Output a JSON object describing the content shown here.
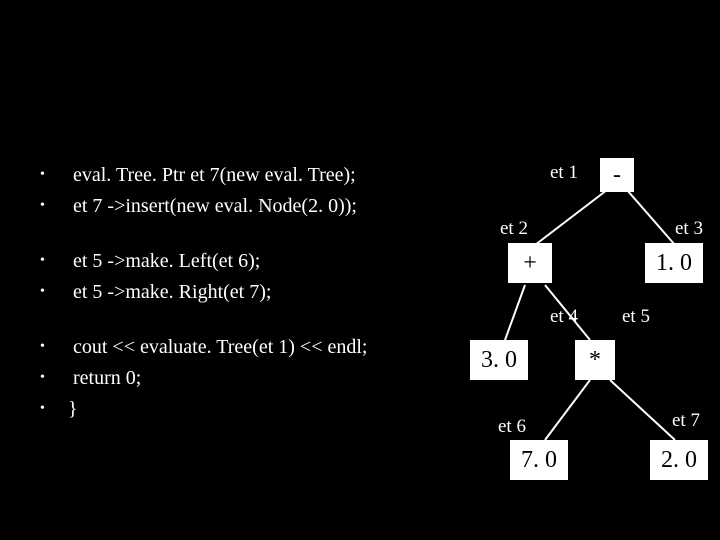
{
  "code": {
    "lines": [
      " eval. Tree. Ptr et 7(new eval. Tree); ",
      " et 7 ->insert(new eval. Node(2. 0));",
      "",
      " et 5 ->make. Left(et 6);",
      " et 5 ->make. Right(et 7);",
      "",
      " cout << evaluate. Tree(et 1) << endl;",
      " return 0;",
      "} "
    ]
  },
  "tree": {
    "labels": {
      "et1": "et 1",
      "et2": "et 2",
      "et3": "et 3",
      "et4": "et 4",
      "et5": "et 5",
      "et6": "et 6",
      "et7": "et 7"
    },
    "nodes": {
      "n1": "-",
      "n2": "+",
      "n3": "1. 0",
      "n4": "3. 0",
      "n5": "*",
      "n6": "7. 0",
      "n7": "2. 0"
    }
  },
  "chart_data": {
    "type": "tree",
    "description": "Binary expression tree for  ( (3.0 + (7.0 * 2.0)) - 1.0 )  with named pointers et1..et7",
    "nodes": [
      {
        "id": "et1",
        "value": "-",
        "left": "et2",
        "right": "et3"
      },
      {
        "id": "et2",
        "value": "+",
        "left": "et4",
        "right": "et5"
      },
      {
        "id": "et3",
        "value": 1.0
      },
      {
        "id": "et4",
        "value": 3.0
      },
      {
        "id": "et5",
        "value": "*",
        "left": "et6",
        "right": "et7"
      },
      {
        "id": "et6",
        "value": 7.0
      },
      {
        "id": "et7",
        "value": 2.0
      }
    ],
    "root": "et1"
  }
}
